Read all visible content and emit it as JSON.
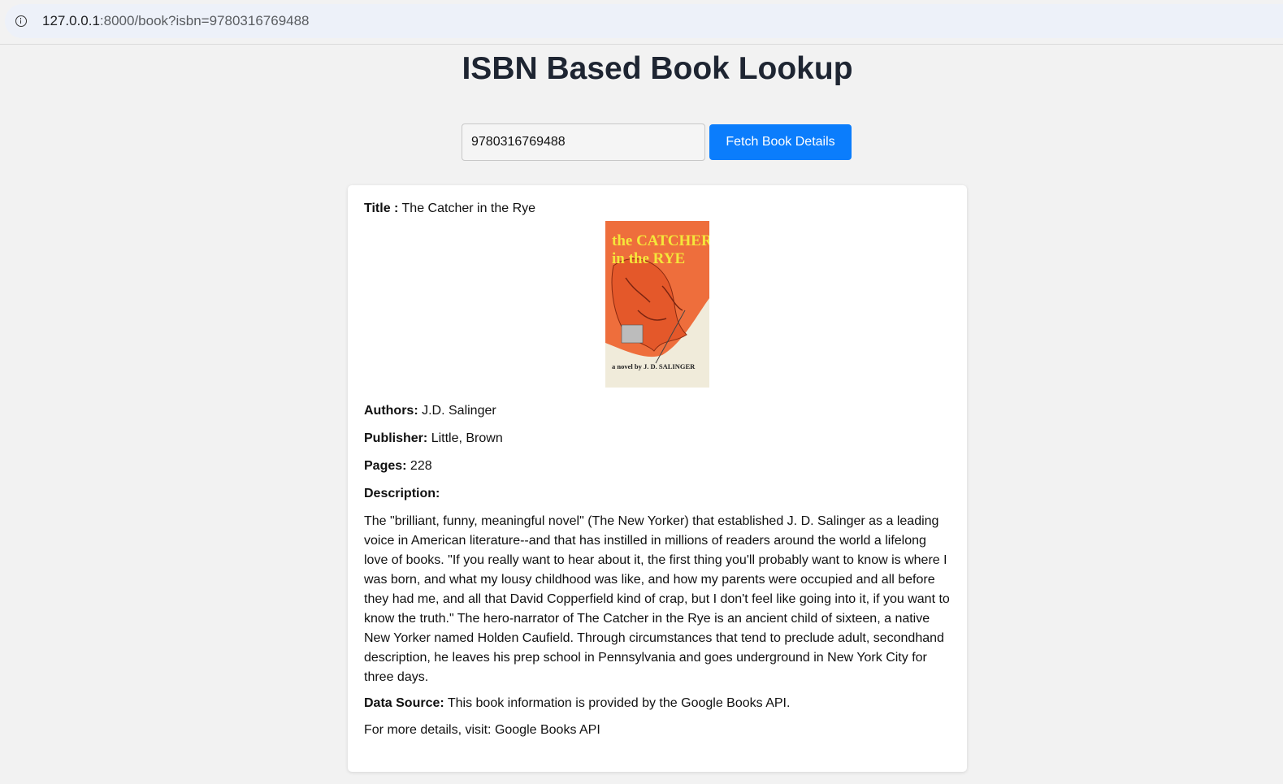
{
  "browser": {
    "url_host": "127.0.0.1",
    "url_rest": ":8000/book?isbn=9780316769488"
  },
  "page": {
    "heading": "ISBN Based Book Lookup",
    "search": {
      "value": "9780316769488",
      "button_label": "Fetch Book Details"
    }
  },
  "book": {
    "title_label": "Title :",
    "title": "The Catcher in the Rye",
    "cover": {
      "title_line1": "the CATCHER",
      "title_line2": "in the RYE",
      "byline": "a novel by J. D. SALINGER",
      "colors": {
        "background": "#f0ebda",
        "orange": "#ee6e3c",
        "yellow": "#f5e63a"
      }
    },
    "authors_label": "Authors:",
    "authors": "J.D. Salinger",
    "publisher_label": "Publisher:",
    "publisher": "Little, Brown",
    "pages_label": "Pages:",
    "pages": "228",
    "description_label": "Description:",
    "description": "The \"brilliant, funny, meaningful novel\" (The New Yorker) that established J. D. Salinger as a leading voice in American literature--and that has instilled in millions of readers around the world a lifelong love of books. \"If you really want to hear about it, the first thing you'll probably want to know is where I was born, and what my lousy childhood was like, and how my parents were occupied and all before they had me, and all that David Copperfield kind of crap, but I don't feel like going into it, if you want to know the truth.\" The hero-narrator of The Catcher in the Rye is an ancient child of sixteen, a native New Yorker named Holden Caufield. Through circumstances that tend to preclude adult, secondhand description, he leaves his prep school in Pennsylvania and goes underground in New York City for three days.",
    "source_label": "Data Source:",
    "source_text": "This book information is provided by the Google Books API.",
    "more_prefix": "For more details, visit: ",
    "more_link": "Google Books API"
  },
  "colors": {
    "accent": "#0b7dfc",
    "heading": "#1e2532",
    "page_bg": "#f2f2f2"
  }
}
